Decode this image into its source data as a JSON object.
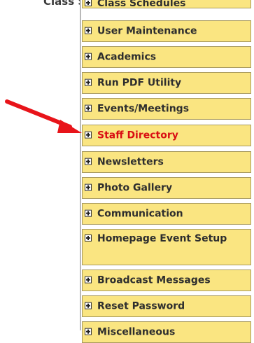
{
  "header": {
    "partial_text": "Class Schedules",
    "partial_accent": "y"
  },
  "menu": {
    "items": [
      {
        "label": "User Maintenance"
      },
      {
        "label": "Academics"
      },
      {
        "label": "Run PDF Utility"
      },
      {
        "label": "Events/Meetings"
      },
      {
        "label": "Staff Directory",
        "active": true
      },
      {
        "label": "Newsletters"
      },
      {
        "label": "Photo Gallery"
      },
      {
        "label": "Communication"
      },
      {
        "label": "Homepage Event Setup"
      },
      {
        "label": "Broadcast Messages"
      },
      {
        "label": "Reset Password"
      },
      {
        "label": "Miscellaneous"
      }
    ]
  },
  "colors": {
    "item_bg": "#fae581",
    "item_border": "#a89a5d",
    "active_text": "#d90f13",
    "arrow": "#e8141a"
  },
  "icons": {
    "expand": "plus-box-icon",
    "pointer": "red-arrow-icon"
  }
}
